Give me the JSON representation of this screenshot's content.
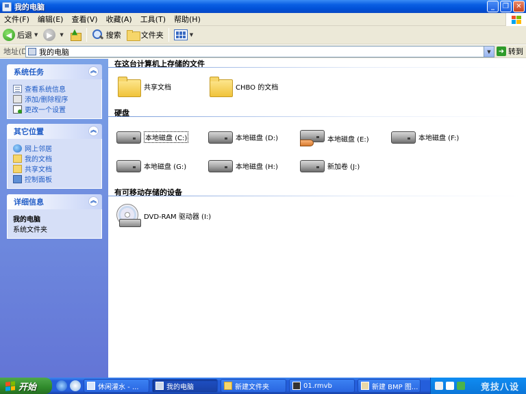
{
  "window": {
    "title": "我的电脑",
    "min_label": "_",
    "max_label": "❐",
    "close_label": "✕"
  },
  "menu": {
    "items": [
      "文件(F)",
      "编辑(E)",
      "查看(V)",
      "收藏(A)",
      "工具(T)",
      "帮助(H)"
    ]
  },
  "toolbar": {
    "back_label": "后退",
    "search_label": "搜索",
    "folders_label": "文件夹"
  },
  "address": {
    "label": "地址(D)",
    "value": "我的电脑",
    "go_label": "转到"
  },
  "sidebar": {
    "system_tasks": {
      "title": "系统任务",
      "links": [
        "查看系统信息",
        "添加/删除程序",
        "更改一个设置"
      ]
    },
    "other_places": {
      "title": "其它位置",
      "links": [
        "网上邻居",
        "我的文档",
        "共享文档",
        "控制面板"
      ]
    },
    "details": {
      "title": "详细信息",
      "name": "我的电脑",
      "type": "系统文件夹"
    }
  },
  "content": {
    "stored_files": {
      "heading": "在这台计算机上存储的文件",
      "items": [
        "共享文档",
        "CHBO 的文档"
      ]
    },
    "hard_disks": {
      "heading": "硬盘",
      "items": [
        "本地磁盘 (C:)",
        "本地磁盘 (D:)",
        "本地磁盘 (E:)",
        "本地磁盘 (F:)",
        "本地磁盘 (G:)",
        "本地磁盘 (H:)",
        "新加卷 (J:)"
      ]
    },
    "removable": {
      "heading": "有可移动存储的设备",
      "items": [
        "DVD-RAM 驱动器 (I:)"
      ]
    }
  },
  "taskbar": {
    "start_label": "开始",
    "tasks": [
      "休闲灌水 - ...",
      "我的电脑",
      "新建文件夹",
      "01.rmvb",
      "新建 BMP 图..."
    ],
    "watermark": "竞技八设"
  },
  "colors": {
    "title_blue": "#0050d6",
    "sidebar_blue": "#7ba2e7",
    "link_blue": "#215dc6",
    "start_green": "#2f8a2b"
  }
}
